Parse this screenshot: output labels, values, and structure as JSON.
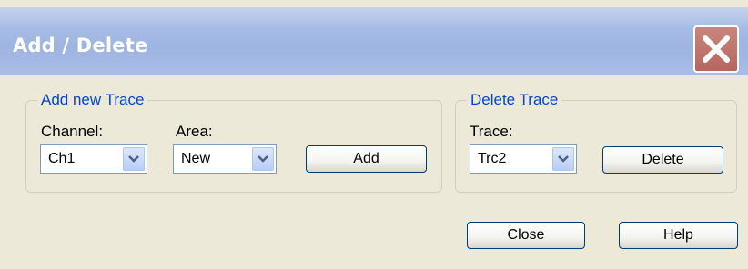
{
  "window": {
    "title": "Add / Delete",
    "close_icon": "close-icon"
  },
  "add_group": {
    "legend": "Add new Trace",
    "channel_label": "Channel:",
    "channel_value": "Ch1",
    "area_label": "Area:",
    "area_value": "New",
    "add_button": "Add"
  },
  "delete_group": {
    "legend": "Delete Trace",
    "trace_label": "Trace:",
    "trace_value": "Trc2",
    "delete_button": "Delete"
  },
  "footer": {
    "close_button": "Close",
    "help_button": "Help"
  },
  "colors": {
    "legend_text": "#0046d5",
    "titlebar": "#a7bce5",
    "close_button_bg": "#b4675e",
    "dialog_bg": "#ece9d8"
  }
}
